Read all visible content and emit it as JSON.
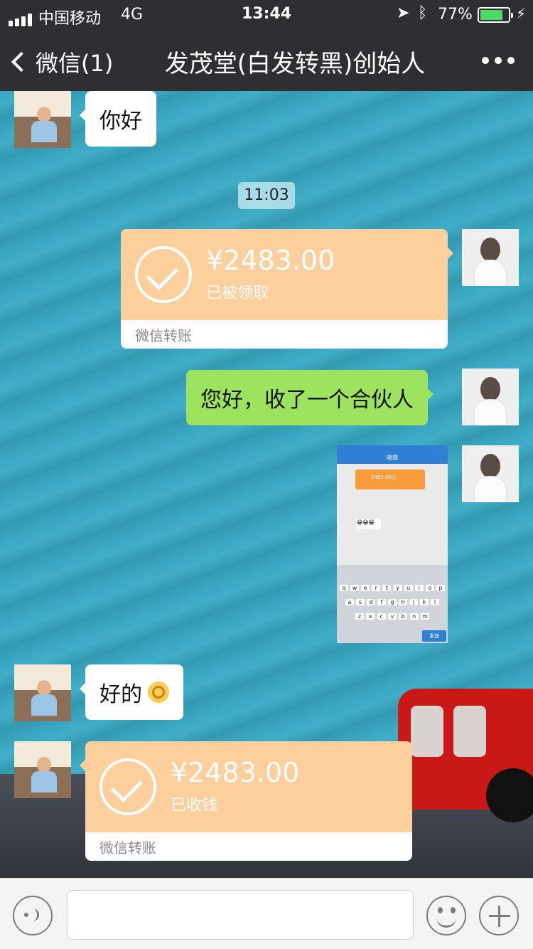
{
  "status": {
    "carrier": "中国移动",
    "network": "4G",
    "time": "13:44",
    "battery": "77%",
    "battery_level": 0.77
  },
  "nav": {
    "back_label": "微信(1)",
    "title": "发茂堂(白发转黑)创始人"
  },
  "messages": {
    "m1": "你好",
    "time_divider": "11:03",
    "transfer1": {
      "amount": "¥2483.00",
      "status": "已被领取",
      "footer": "微信转账"
    },
    "m2": "您好，收了一个合伙人",
    "m3": "好的",
    "transfer2": {
      "amount": "¥2483.00",
      "status": "已收钱",
      "footer": "微信转账"
    }
  },
  "screenshot_thumb": {
    "title": "晓霖",
    "card_amount": "2483.00元",
    "send_key": "发送",
    "keys_row1": [
      "q",
      "w",
      "e",
      "r",
      "t",
      "y",
      "u",
      "i",
      "o",
      "p"
    ],
    "keys_row2": [
      "a",
      "s",
      "d",
      "f",
      "g",
      "h",
      "j",
      "k",
      "l"
    ],
    "keys_row3": [
      "z",
      "x",
      "c",
      "v",
      "b",
      "n",
      "m"
    ]
  },
  "icons": [
    "signal-icon",
    "location-icon",
    "bluetooth-icon",
    "battery-icon",
    "back-chevron-icon",
    "more-icon",
    "check-circle-icon",
    "voice-icon",
    "emoji-icon",
    "plus-icon"
  ],
  "colors": {
    "nav_bg": "#2e2e33",
    "chat_bg": "#3aa6bf",
    "bubble_out": "#9de35f",
    "transfer": "#fdcf9c"
  }
}
